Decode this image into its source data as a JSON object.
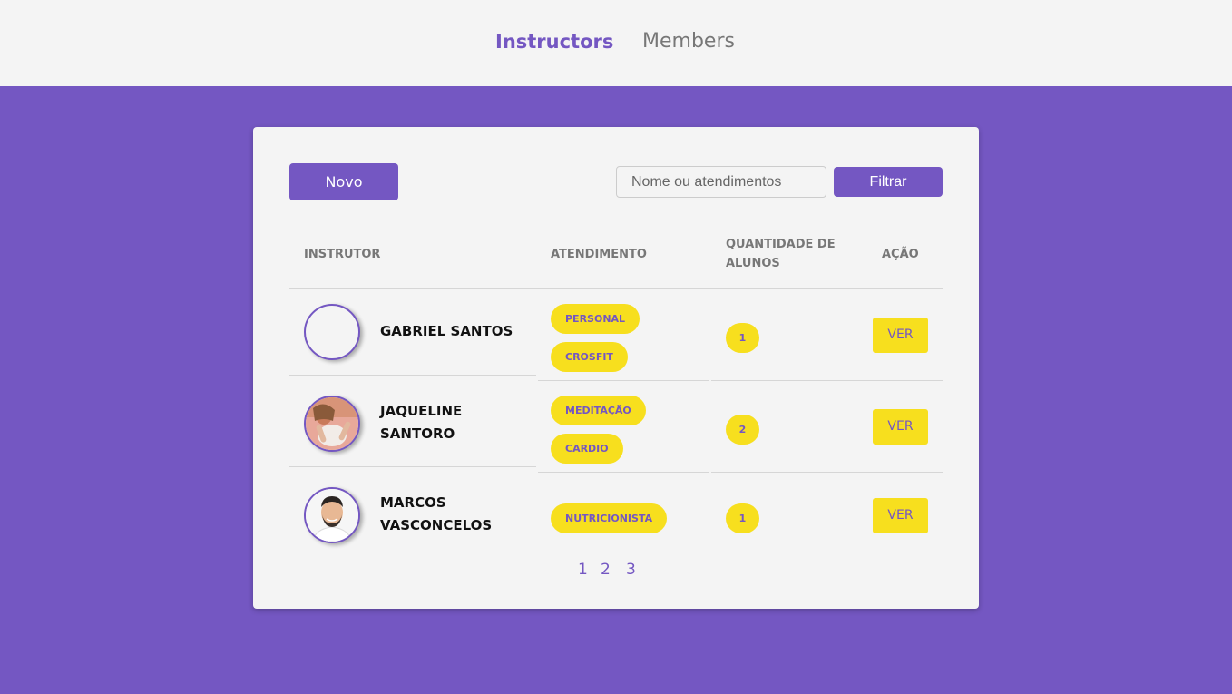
{
  "nav": {
    "instructors": "Instructors",
    "members": "Members"
  },
  "toolbar": {
    "new_label": "Novo",
    "search_placeholder": "Nome ou atendimentos",
    "search_value": "",
    "filter_label": "Filtrar"
  },
  "table": {
    "headers": {
      "instructor": "INSTRUTOR",
      "services": "ATENDIMENTO",
      "students": "QUANTIDADE DE ALUNOS",
      "action": "AÇÃO"
    },
    "rows": [
      {
        "name": "GABRIEL SANTOS",
        "services": [
          "PERSONAL",
          "CROSFIT"
        ],
        "students": "1",
        "action": "VER"
      },
      {
        "name": "JAQUELINE SANTORO",
        "services": [
          "MEDITAÇÃO",
          "CARDIO"
        ],
        "students": "2",
        "action": "VER"
      },
      {
        "name": "MARCOS VASCONCELOS",
        "services": [
          "NUTRICIONISTA"
        ],
        "students": "1",
        "action": "VER"
      }
    ]
  },
  "pagination": [
    "1",
    "2",
    "3"
  ],
  "colors": {
    "primary": "#7457c2",
    "accent": "#f7df1e",
    "surface": "#f4f4f4"
  }
}
